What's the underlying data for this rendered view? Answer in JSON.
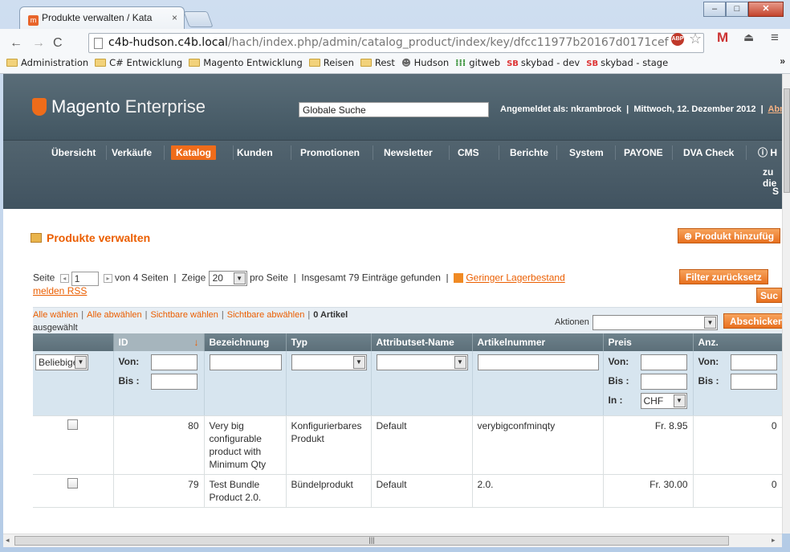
{
  "browser": {
    "tab_title": "Produkte verwalten / Kata",
    "tab_close": "×",
    "url_host": "c4b-hudson.c4b.local",
    "url_path": "/hach/index.php/admin/catalog_product/index/key/dfcc11977b20167d0171cef",
    "abp_label": "ABP",
    "bookmarks": [
      {
        "label": "Administration",
        "icon": "folder-icon"
      },
      {
        "label": "C# Entwicklung",
        "icon": "folder-icon"
      },
      {
        "label": "Magento Entwicklung",
        "icon": "folder-icon"
      },
      {
        "label": "Reisen",
        "icon": "folder-icon"
      },
      {
        "label": "Rest",
        "icon": "folder-icon"
      },
      {
        "label": "Hudson",
        "icon": "hudson-icon"
      },
      {
        "label": "gitweb",
        "icon": "gitweb-icon"
      },
      {
        "label": "skybad - dev",
        "icon": "sb-icon",
        "prefix": "SB"
      },
      {
        "label": "skybad - stage",
        "icon": "sb-icon",
        "prefix": "SB"
      }
    ],
    "bookmarks_more": "»"
  },
  "header": {
    "logo_brand": "Magento",
    "logo_edition": "Enterprise",
    "global_search_placeholder": "Globale Suche",
    "logged_in": "Angemeldet als: nkrambrock",
    "date": "Mittwoch, 12. Dezember 2012",
    "logout": "Abme"
  },
  "nav": {
    "items": [
      "Übersicht",
      "Verkäufe",
      "Katalog",
      "Kunden",
      "Promotionen",
      "Newsletter",
      "CMS",
      "Berichte",
      "System",
      "PAYONE",
      "DVA Check"
    ],
    "active": "Katalog",
    "help_partial": "H",
    "extra_line1": "zu die",
    "extra_line2": "S"
  },
  "page": {
    "title": "Produkte verwalten",
    "add_button": "Produkt hinzufüg",
    "reset_filter_button": "Filter zurücksetz",
    "search_button": "Suc",
    "pager": {
      "label_page": "Seite",
      "page": "1",
      "of_pages": "von 4 Seiten",
      "show": "Zeige",
      "per_page": "20",
      "per_page_label": "pro Seite",
      "total": "Insgesamt 79 Einträge gefunden",
      "rss_link": "Geringer Lagerbestand",
      "rss_link2": "melden RSS"
    },
    "mass": {
      "select_all": "Alle wählen",
      "deselect_all": "Alle abwählen",
      "select_visible": "Sichtbare wählen",
      "deselect_visible": "Sichtbare abwählen",
      "count": "0 Artikel",
      "selected_label": "ausgewählt",
      "actions_label": "Aktionen",
      "submit": "Abschicken"
    }
  },
  "grid": {
    "columns": [
      "",
      "ID",
      "Bezeichnung",
      "Typ",
      "Attributset-Name",
      "Artikelnummer",
      "Preis",
      "Anz."
    ],
    "filter": {
      "any_option": "Beliebige",
      "from": "Von:",
      "to": "Bis :",
      "in": "In :",
      "currency": "CHF"
    },
    "rows": [
      {
        "id": "80",
        "name": "Very big configurable product with Minimum Qty",
        "type": "Konfigurierbares Produkt",
        "attrset": "Default",
        "sku": "verybigconfminqty",
        "price": "Fr. 8.95",
        "qty": "0"
      },
      {
        "id": "79",
        "name": "Test Bundle Product 2.0.",
        "type": "Bündelprodukt",
        "attrset": "Default",
        "sku": "2.0.",
        "price": "Fr. 30.00",
        "qty": "0"
      }
    ]
  },
  "colors": {
    "accent": "#eb5e00",
    "header_bg": "#4d606b",
    "filter_bg": "#d7e5ef"
  }
}
